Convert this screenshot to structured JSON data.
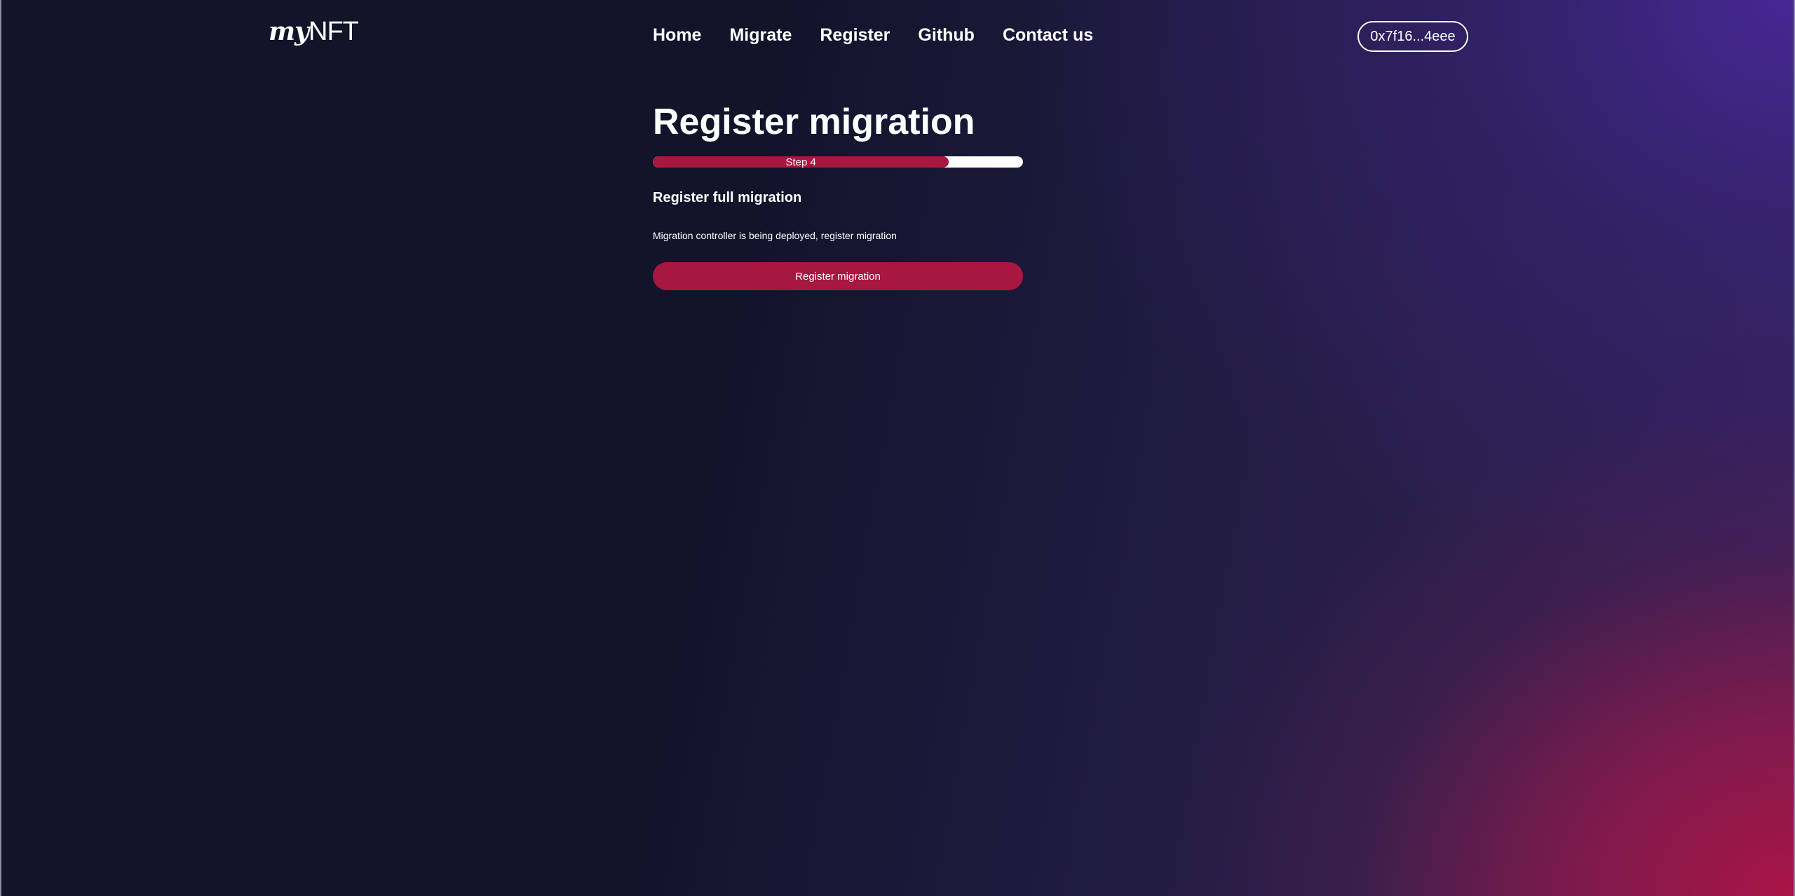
{
  "brand": {
    "logo_my": "my",
    "logo_nft": "NFT"
  },
  "nav": {
    "items": [
      {
        "label": "Home"
      },
      {
        "label": "Migrate"
      },
      {
        "label": "Register"
      },
      {
        "label": "Github"
      },
      {
        "label": "Contact us"
      }
    ]
  },
  "wallet": {
    "address": "0x7f16...4eee"
  },
  "main": {
    "title": "Register migration",
    "progress": {
      "label": "Step 4",
      "fraction": 0.8
    },
    "subtitle": "Register full migration",
    "description": "Migration controller is being deployed, register migration",
    "button_label": "Register migration"
  },
  "colors": {
    "accent": "#a8173f",
    "background": "#12142a",
    "text": "#ffffff"
  }
}
